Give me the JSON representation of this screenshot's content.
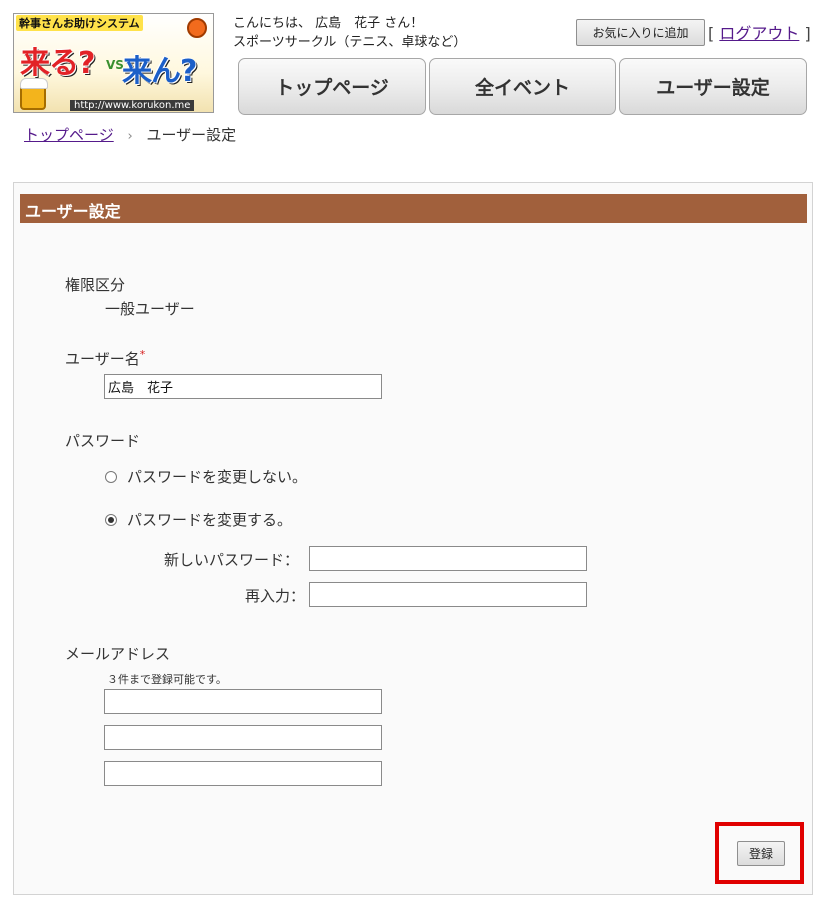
{
  "logo": {
    "tagline": "幹事さんお助けシステム",
    "word1": "来る?",
    "vs": "VS",
    "word2": "来ん?",
    "url": "http://www.korukon.me"
  },
  "header": {
    "greeting_line1": "こんにちは、 広島　花子 さん！",
    "greeting_line2": "スポーツサークル（テニス、卓球など）",
    "favorite_button": "お気に入りに追加",
    "logout_open": "[",
    "logout_link": "ログアウト",
    "logout_close": "]"
  },
  "nav": {
    "top": "トップページ",
    "events": "全イベント",
    "user_settings": "ユーザー設定"
  },
  "breadcrumb": {
    "home": "トップページ",
    "separator": "›",
    "current": "ユーザー設定"
  },
  "panel": {
    "title": "ユーザー設定",
    "role_label": "権限区分",
    "role_value": "一般ユーザー",
    "username_label": "ユーザー名",
    "required_mark": "*",
    "username_value": "広島　花子",
    "password_label": "パスワード",
    "radio_keep": "パスワードを変更しない。",
    "radio_change": "パスワードを変更する。",
    "new_password_label": "新しいパスワード：",
    "new_password_value": "",
    "confirm_label": "再入力：",
    "confirm_value": "",
    "email_label": "メールアドレス",
    "email_note": "３件まで登録可能です。",
    "emails": [
      "",
      "",
      ""
    ],
    "submit_button": "登録"
  },
  "colors": {
    "panel_header": "#a1603c",
    "highlight_frame": "#e00000",
    "link": "#551a8b"
  }
}
